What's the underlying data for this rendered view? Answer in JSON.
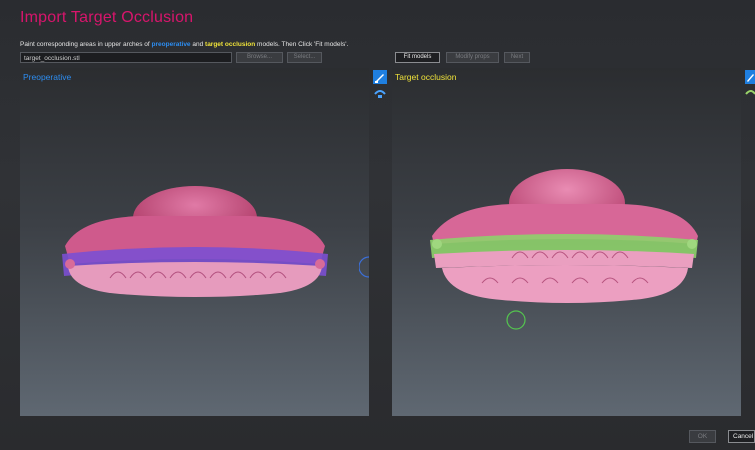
{
  "dialog": {
    "title": "Import Target Occlusion"
  },
  "instruction": {
    "part1": "Paint corresponding areas in upper arches of ",
    "preoperative_word": "preoperative",
    "part2": " and ",
    "target_word": "target occlusion",
    "part3": " models. Then Click 'Fit models'."
  },
  "file_field": {
    "value": "target_occlusion.stl"
  },
  "buttons": {
    "browse": "Browse...",
    "select": "Select...",
    "fit_models": "Fit models",
    "modify_props": "Modify props",
    "next": "Next",
    "ok": "OK",
    "cancel": "Cancel"
  },
  "views": {
    "preoperative": {
      "label": "Preoperative",
      "color": "#2d8df0"
    },
    "target": {
      "label": "Target occlusion",
      "color": "#f0e33a"
    }
  },
  "colors": {
    "title": "#d8156c",
    "gum": "#d24f86",
    "paint_pre": "#7a4fd0",
    "paint_tgt": "#8fd06a"
  },
  "icons": {
    "paint_brush": "paint-brush-icon",
    "arch_select": "arch-select-icon"
  }
}
